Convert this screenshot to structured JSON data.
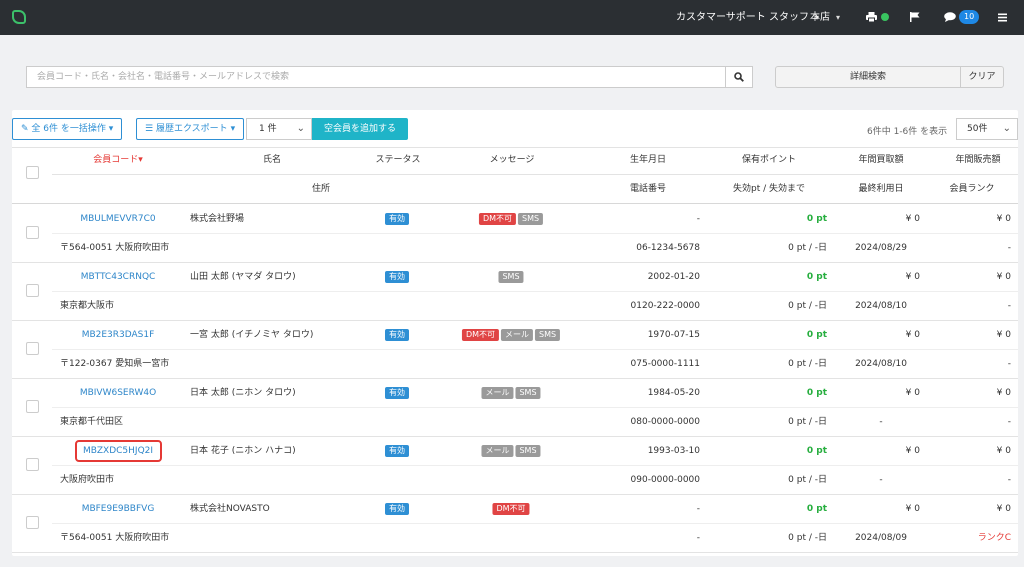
{
  "header": {
    "staff_label": "カスタマーサポート スタッフ",
    "store_label": "本店",
    "chat_count": "10",
    "colors": {
      "bar": "#2b2f33",
      "status_online": "#39c460",
      "badge": "#1e88e5"
    }
  },
  "search": {
    "placeholder": "会員コード・氏名・会社名・電話番号・メールアドレスで検索",
    "advanced_label": "詳細検索",
    "clear_label": "クリア"
  },
  "toolbar": {
    "bulk_label": "全 6件 を一括操作",
    "export_label": "履歴エクスポート",
    "count_value": "1 件",
    "add_label": "空会員を追加する",
    "pager_text": "6件中 1-6件 を表示",
    "per_page": "50件"
  },
  "table": {
    "headers_row1": [
      "会員コード",
      "氏名",
      "ステータス",
      "メッセージ",
      "生年月日",
      "保有ポイント",
      "年間買取額",
      "年間販売額"
    ],
    "headers_row2": [
      "住所",
      "電話番号",
      "失効pt / 失効まで",
      "最終利用日",
      "会員ランク"
    ],
    "rows": [
      {
        "code": "MBULMEVVR7C0",
        "name": "株式会社野場",
        "status": "有効",
        "tags": [
          "DM不可",
          "SMS"
        ],
        "birth": "-",
        "points": "0 pt",
        "buy": "¥ 0",
        "sell": "¥ 0",
        "address": "〒564-0051 大阪府吹田市",
        "phone": "06-1234-5678",
        "expire": "0 pt / -日",
        "last_used": "2024/08/29",
        "rank": "-"
      },
      {
        "code": "MBTTC43CRNQC",
        "name": "山田 太郎 (ヤマダ タロウ)",
        "status": "有効",
        "tags": [
          "SMS"
        ],
        "birth": "2002-01-20",
        "points": "0 pt",
        "buy": "¥ 0",
        "sell": "¥ 0",
        "address": "東京都大阪市",
        "phone": "0120-222-0000",
        "expire": "0 pt / -日",
        "last_used": "2024/08/10",
        "rank": "-"
      },
      {
        "code": "MB2E3R3DAS1F",
        "name": "一宮 太郎 (イチノミヤ タロウ)",
        "status": "有効",
        "tags": [
          "DM不可",
          "メール",
          "SMS"
        ],
        "birth": "1970-07-15",
        "points": "0 pt",
        "buy": "¥ 0",
        "sell": "¥ 0",
        "address": "〒122-0367 愛知県一宮市",
        "phone": "075-0000-1111",
        "expire": "0 pt / -日",
        "last_used": "2024/08/10",
        "rank": "-"
      },
      {
        "code": "MBIVW6SERW4O",
        "name": "日本 太郎 (ニホン タロウ)",
        "status": "有効",
        "tags": [
          "メール",
          "SMS"
        ],
        "birth": "1984-05-20",
        "points": "0 pt",
        "buy": "¥ 0",
        "sell": "¥ 0",
        "address": "東京都千代田区",
        "phone": "080-0000-0000",
        "expire": "0 pt / -日",
        "last_used": "-",
        "rank": "-"
      },
      {
        "code": "MBZXDC5HJQ2I",
        "name": "日本 花子 (ニホン ハナコ)",
        "status": "有効",
        "tags": [
          "メール",
          "SMS"
        ],
        "birth": "1993-03-10",
        "points": "0 pt",
        "buy": "¥ 0",
        "sell": "¥ 0",
        "address": "大阪府吹田市",
        "phone": "090-0000-0000",
        "expire": "0 pt / -日",
        "last_used": "-",
        "rank": "-"
      },
      {
        "code": "MBFE9E9BBFVG",
        "name": "株式会社NOVASTO",
        "status": "有効",
        "tags": [
          "DM不可"
        ],
        "birth": "-",
        "points": "0 pt",
        "buy": "¥ 0",
        "sell": "¥ 0",
        "address": "〒564-0051 大阪府吹田市",
        "phone": "-",
        "expire": "0 pt / -日",
        "last_used": "2024/08/09",
        "rank": "ランクC"
      }
    ],
    "colors": {
      "link": "#2e86c9",
      "points": "#27ae3f",
      "tag_valid": "#2e8fd4",
      "tag_dm": "#e04444",
      "tag_gray": "#9a9a9a",
      "highlight": "#e53935"
    }
  }
}
